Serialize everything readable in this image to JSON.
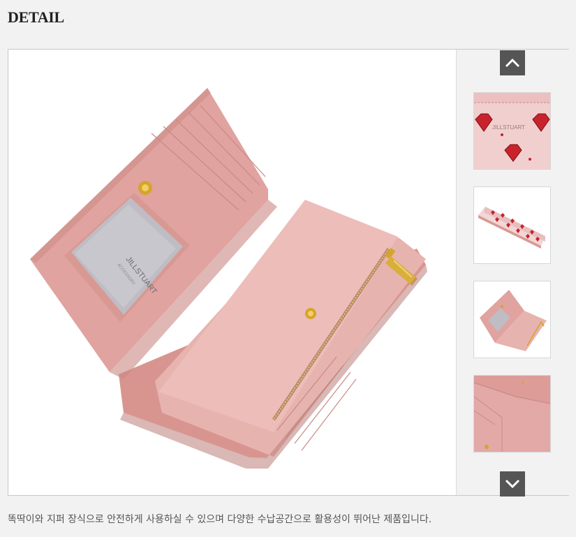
{
  "section": {
    "title": "DETAIL"
  },
  "main_image": {
    "description_label": "JILLSTUART",
    "sub_label": "ACCESSORY"
  },
  "thumbnails": {
    "items": [
      {
        "name": "thumb-heart-pattern-closeup",
        "logo_text": "JILLSTUART"
      },
      {
        "name": "thumb-wallet-closed-side"
      },
      {
        "name": "thumb-wallet-open"
      },
      {
        "name": "thumb-wallet-interior-closeup"
      }
    ],
    "up_icon": "chevron-up-icon",
    "down_icon": "chevron-down-icon"
  },
  "caption": {
    "text": "똑딱이와 지퍼 장식으로 안전하게 사용하실 수 있으며 다양한 수납공간으로 활용성이 뛰어난 제품입니다."
  },
  "colors": {
    "wallet_pink": "#e3a9a6",
    "wallet_pink_dark": "#c98985",
    "gold": "#d4a52a",
    "rail_bg": "#f2f2f2",
    "arrow_bg": "#555555",
    "heart_red": "#c8232c"
  }
}
